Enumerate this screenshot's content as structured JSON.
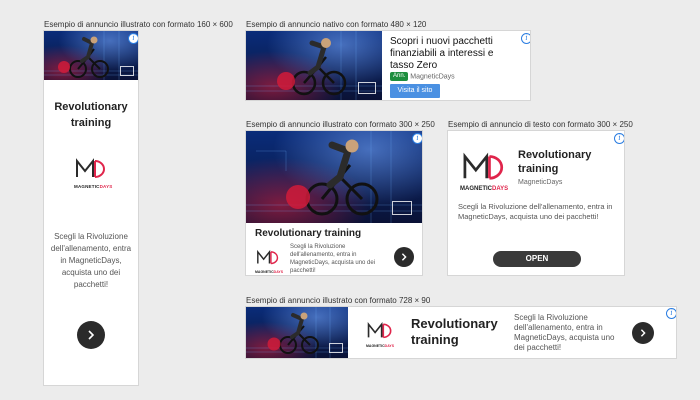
{
  "captions": {
    "c160x600": "Esempio di annuncio illustrato con formato 160 × 600",
    "native": "Esempio di annuncio nativo con formato 480 × 120",
    "c300x250": "Esempio di annuncio illustrato con formato 300 × 250",
    "text300x250": "Esempio di annuncio di testo con formato 300 × 250",
    "c728x90": "Esempio di annuncio illustrato con formato 728 × 90"
  },
  "brand": {
    "name": "MagneticDays",
    "logo_word_a": "MAGNETIC",
    "logo_word_b": "DAYS",
    "accent": "#e0254b",
    "dark": "#2b2b2b",
    "link_blue": "#2a7de1"
  },
  "info_glyph": "i",
  "ad160": {
    "headline": "Revolutionary training",
    "body": "Scegli la Rivoluzione dell'allenamento, entra in MagneticDays, acquista uno dei pacchetti!"
  },
  "native": {
    "headline": "Scopri i nuovi pacchetti finanziabili a interessi e tasso Zero",
    "badge": "Ann.",
    "advertiser": "MagneticDays",
    "cta": "Visita il sito"
  },
  "ad300": {
    "headline": "Revolutionary training",
    "body": "Scegli la Rivoluzione dell'allenamento, entra in MagneticDays, acquista uno dei pacchetti!"
  },
  "text300": {
    "headline": "Revolutionary training",
    "advertiser": "MagneticDays",
    "body": "Scegli la Rivoluzione dell'allenamento, entra in MagneticDays, acquista uno dei pacchetti!",
    "cta": "OPEN"
  },
  "ad728": {
    "headline": "Revolutionary training",
    "body": "Scegli la Rivoluzione dell'allenamento, entra in MagneticDays, acquista uno dei pacchetti!"
  }
}
